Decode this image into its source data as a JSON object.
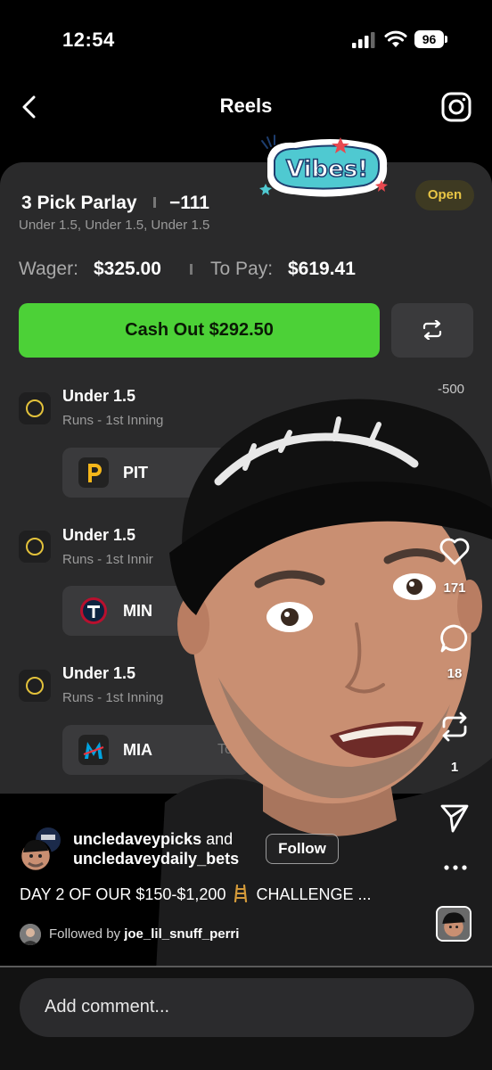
{
  "status_bar": {
    "time": "12:54",
    "battery": "96"
  },
  "nav": {
    "title": "Reels"
  },
  "sticker": {
    "text": "Vibes!"
  },
  "bet": {
    "title": "3 Pick Parlay",
    "odds": "−111",
    "subtitle": "Under 1.5, Under 1.5, Under 1.5",
    "status": "Open",
    "wager_label": "Wager:",
    "wager_value": "$325.00",
    "topay_label": "To Pay:",
    "topay_value": "$619.41",
    "cashout_label": "Cash Out $292.50",
    "legs": [
      {
        "title": "Under 1.5",
        "market": "Runs - 1st Inning",
        "odds": "-500",
        "team": "PIT"
      },
      {
        "title": "Under 1.5",
        "market": "Runs - 1st Innir",
        "team": "MIN"
      },
      {
        "title": "Under 1.5",
        "market": "Runs - 1st Inning",
        "team": "MIA",
        "extra": "To"
      }
    ]
  },
  "actions": {
    "likes": "171",
    "comments": "18",
    "reposts": "1"
  },
  "post": {
    "creator1": "uncledaveypicks",
    "and_text": "and",
    "creator2": "uncledaveydaily_bets",
    "follow_label": "Follow",
    "caption_part1": "DAY 2 OF OUR $150-$1,200",
    "caption_part2": "CHALLENGE ...",
    "followed_prefix": "Followed by",
    "followed_user": "joe_lil_snuff_perri"
  },
  "comment": {
    "placeholder": "Add comment..."
  },
  "colors": {
    "cashout": "#4cd137",
    "open_text": "#e8c545",
    "radio": "#e3c23b",
    "card": "#2a2a2b"
  }
}
